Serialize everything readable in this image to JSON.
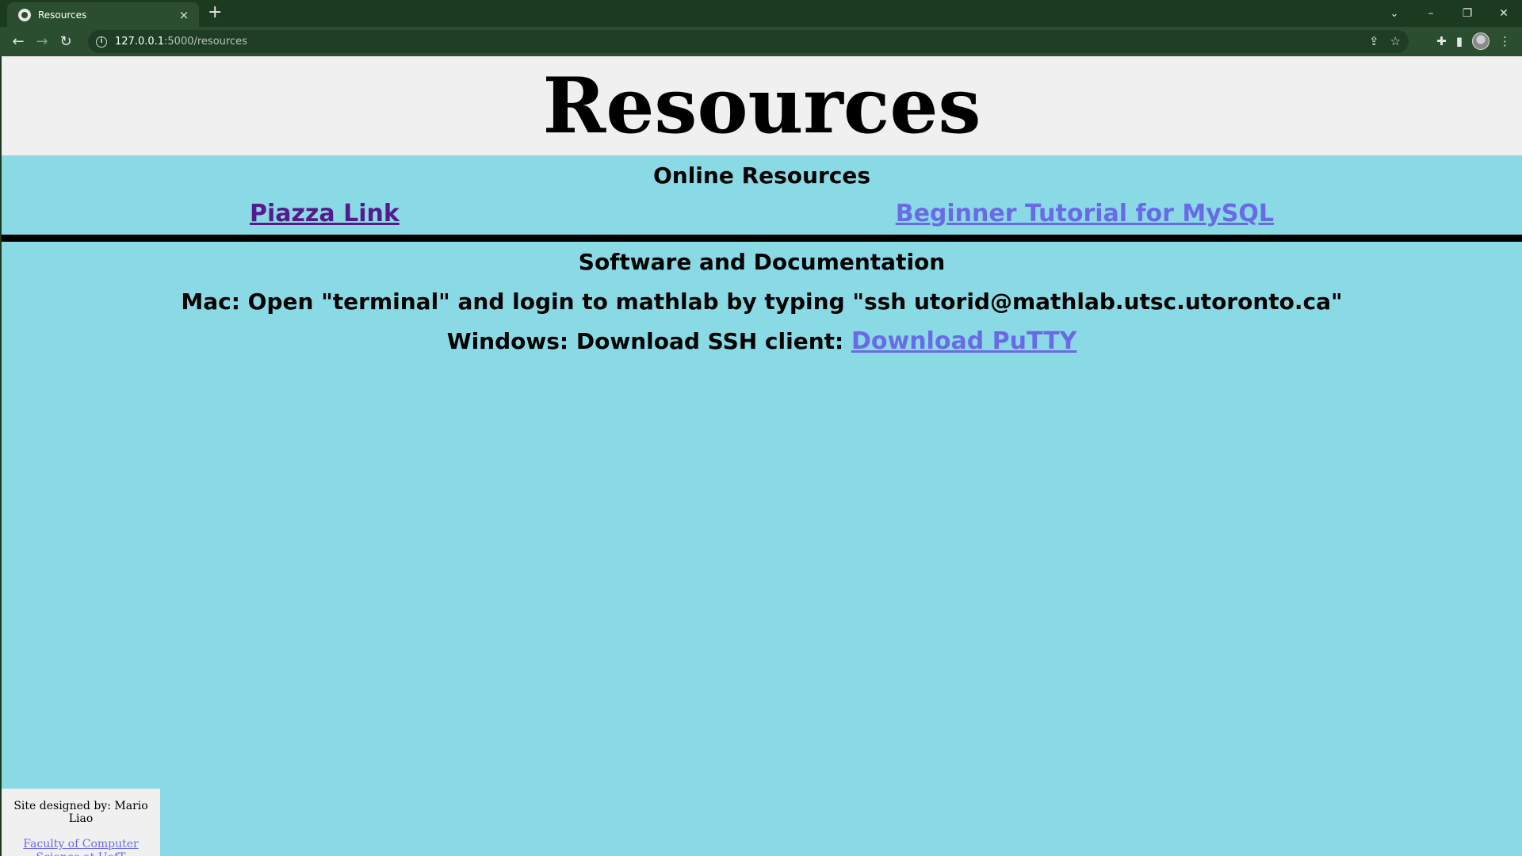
{
  "browser": {
    "tab_title": "Resources",
    "new_tab_label": "+",
    "tab_close_label": "×",
    "url_host": "127.0.0.1",
    "url_rest": ":5000/resources",
    "window_controls": {
      "dropdown": "⌄",
      "minimize": "–",
      "restore": "❐",
      "close": "✕"
    },
    "nav": {
      "back": "←",
      "forward": "→",
      "reload": "↻"
    },
    "omnibox_icons": {
      "share": "⇪",
      "bookmark": "☆"
    },
    "toolbar_icons": {
      "extensions": "✚",
      "side_panel": "▮",
      "menu": "⋮"
    }
  },
  "page": {
    "title": "Resources",
    "online": {
      "heading": "Online Resources",
      "links": [
        {
          "label": "Piazza Link",
          "visited": true
        },
        {
          "label": "Beginner Tutorial for MySQL",
          "visited": false
        }
      ]
    },
    "software": {
      "heading": "Software and Documentation",
      "mac_text": "Mac: Open \"terminal\" and login to mathlab by typing \"ssh utorid@mathlab.utsc.utoronto.ca\"",
      "windows_text": "Windows: Download SSH client: ",
      "windows_link": "Download PuTTY"
    },
    "footer": {
      "credit": "Site designed by: Mario Liao",
      "link": "Faculty of Computer Science at UofT"
    }
  },
  "colors": {
    "page_background": "#89dae5",
    "header_background": "#f1f0f1",
    "visited_link": "#551a8b",
    "link": "#6a6ae8",
    "chrome_dark": "#1c3a1f",
    "chrome_toolbar": "#2b4e30"
  }
}
